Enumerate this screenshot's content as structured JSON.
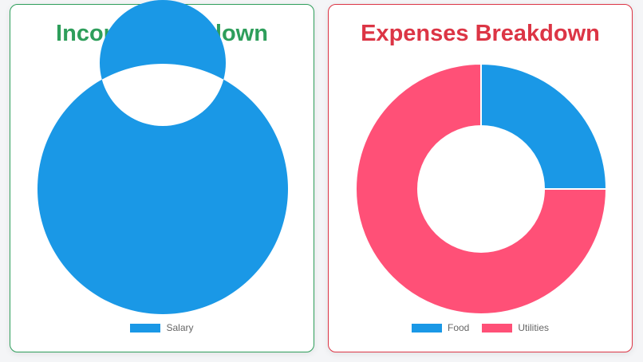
{
  "chart_data": [
    {
      "type": "pie",
      "title": "Income Breakdown",
      "categories": [
        "Salary"
      ],
      "values": [
        100
      ],
      "colors": [
        "#1a98e6"
      ],
      "title_color": "#2e9e5b",
      "donut": true,
      "legend": "bottom"
    },
    {
      "type": "pie",
      "title": "Expenses Breakdown",
      "categories": [
        "Food",
        "Utilities"
      ],
      "values": [
        25,
        75
      ],
      "colors": [
        "#1a98e6",
        "#ff5077"
      ],
      "title_color": "#dc3545",
      "donut": true,
      "legend": "bottom"
    }
  ]
}
